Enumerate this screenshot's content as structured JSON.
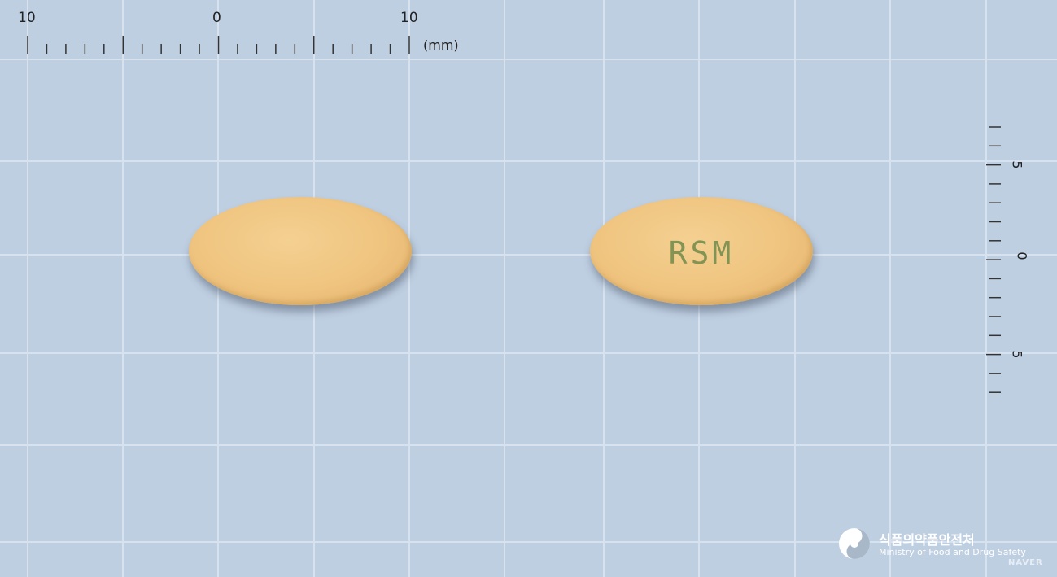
{
  "ruler_top": {
    "left_label": "10",
    "center_label": "0",
    "right_label": "10",
    "unit": "(mm)"
  },
  "ruler_right": {
    "upper_label": "5",
    "center_label": "0",
    "lower_label": "5"
  },
  "pill": {
    "back_imprint": "RSM",
    "color": "#efc47f",
    "imprint_color": "#6f8a4a"
  },
  "watermark": {
    "org_name_kr": "식품의약품안전처",
    "org_name_en": "Ministry of Food and Drug Safety",
    "brand": "NAVER"
  },
  "colors": {
    "background": "#bfcfe2",
    "grid": "#d9e3ef"
  }
}
